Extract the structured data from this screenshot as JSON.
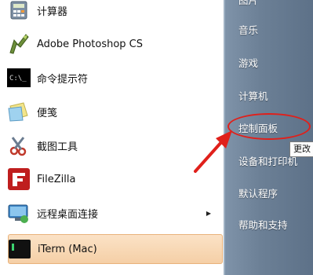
{
  "left_menu": {
    "items": [
      {
        "label": "计算器",
        "icon": "calculator-icon"
      },
      {
        "label": "Adobe Photoshop CS",
        "icon": "photoshop-icon"
      },
      {
        "label": "命令提示符",
        "icon": "command-prompt-icon"
      },
      {
        "label": "便笺",
        "icon": "sticky-notes-icon"
      },
      {
        "label": "截图工具",
        "icon": "snipping-tool-icon"
      },
      {
        "label": "FileZilla",
        "icon": "filezilla-icon"
      },
      {
        "label": "远程桌面连接",
        "icon": "remote-desktop-icon",
        "submenu": true
      },
      {
        "label": "iTerm (Mac)",
        "icon": "iterm-icon",
        "highlighted": true
      }
    ]
  },
  "right_menu": {
    "items": [
      {
        "label": "图片"
      },
      {
        "label": "音乐"
      },
      {
        "label": "游戏"
      },
      {
        "label": "计算机"
      },
      {
        "label": "控制面板"
      },
      {
        "label": "设备和打印机"
      },
      {
        "label": "默认程序"
      },
      {
        "label": "帮助和支持"
      }
    ]
  },
  "tooltip": {
    "text": "更改"
  },
  "colors": {
    "annotation": "#e0201b",
    "highlight": "#f5cfa6",
    "right_panel": "#6c8096"
  }
}
